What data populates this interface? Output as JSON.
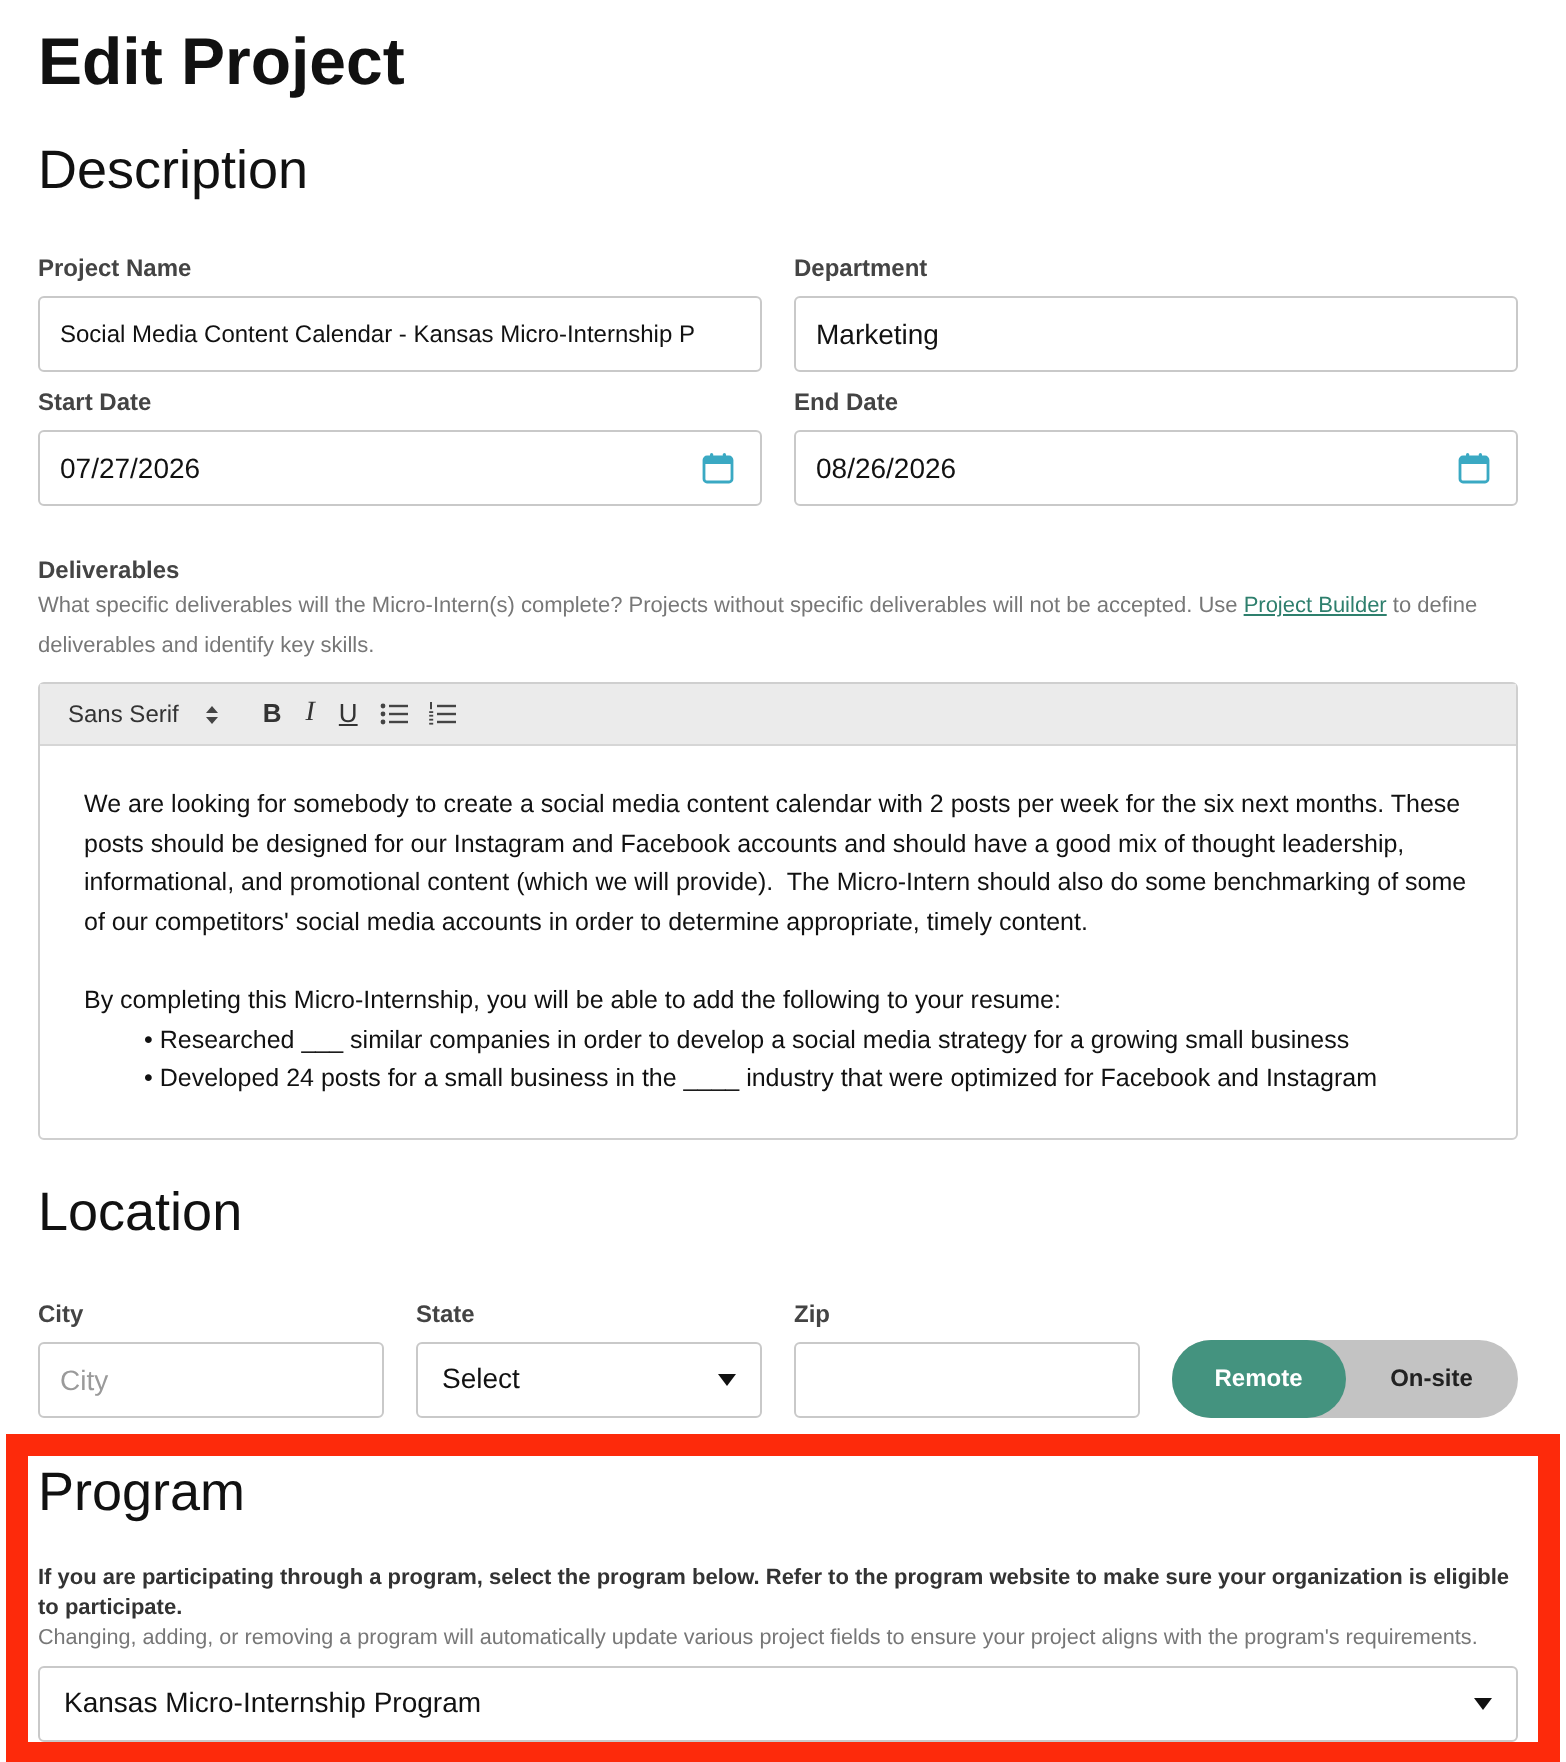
{
  "page": {
    "title": "Edit Project"
  },
  "description": {
    "heading": "Description",
    "fields": [
      {
        "label": "Project Name",
        "kind": "text",
        "value": "Social Media Content Calendar - Kansas Micro-Internship P"
      },
      {
        "label": "Department",
        "kind": "text",
        "value": "Marketing"
      },
      {
        "label": "Start Date",
        "kind": "date",
        "value": "07/27/2026"
      },
      {
        "label": "End Date",
        "kind": "date",
        "value": "08/26/2026"
      }
    ]
  },
  "deliverables": {
    "label": "Deliverables",
    "help_before": "What specific deliverables will the Micro-Intern(s) complete? Projects without specific deliverables will not be accepted. Use ",
    "help_link": "Project Builder",
    "help_after": " to define deliverables and identify key skills.",
    "toolbar": {
      "font": "Sans Serif",
      "buttons": [
        {
          "kind": "bold",
          "label": "B"
        },
        {
          "kind": "italic",
          "label": "I"
        },
        {
          "kind": "underline",
          "label": "U"
        },
        {
          "kind": "bullet-list"
        },
        {
          "kind": "ordered-list"
        }
      ]
    },
    "content": [
      {
        "kind": "paragraph",
        "text": "We are looking for somebody to create a social media content calendar with 2 posts per week for the six next months. These posts should be designed for our Instagram and Facebook accounts and should have a good mix of thought leadership, informational, and promotional content (which we will provide).  The Micro-Intern should also do some benchmarking of some of our competitors' social media accounts in order to determine appropriate, timely content."
      },
      {
        "kind": "paragraph",
        "text": "By completing this Micro-Internship, you will be able to add the following to your resume:"
      },
      {
        "kind": "bullet",
        "text": "• Researched ___ similar companies in order to develop a social media strategy for a growing small business"
      },
      {
        "kind": "bullet",
        "text": "• Developed 24 posts for a small business in the ____ industry that were optimized for Facebook and Instagram"
      }
    ]
  },
  "location": {
    "heading": "Location",
    "fields": [
      {
        "label": "City",
        "kind": "text",
        "placeholder": "City"
      },
      {
        "label": "State",
        "kind": "select",
        "value": "Select"
      },
      {
        "label": "Zip",
        "kind": "text"
      }
    ],
    "work_mode": [
      {
        "label": "Remote",
        "selected": true
      },
      {
        "label": "On-site",
        "selected": false
      }
    ]
  },
  "program": {
    "highlighted": true,
    "heading": "Program",
    "instruction": "If you are participating through a program, select the program below. Refer to the program website to make sure your organization is eligible to participate.",
    "note": "Changing, adding, or removing a program will automatically update various project fields to ensure your project aligns with the program's requirements.",
    "select": {
      "value": "Kansas Micro-Internship Program"
    }
  }
}
